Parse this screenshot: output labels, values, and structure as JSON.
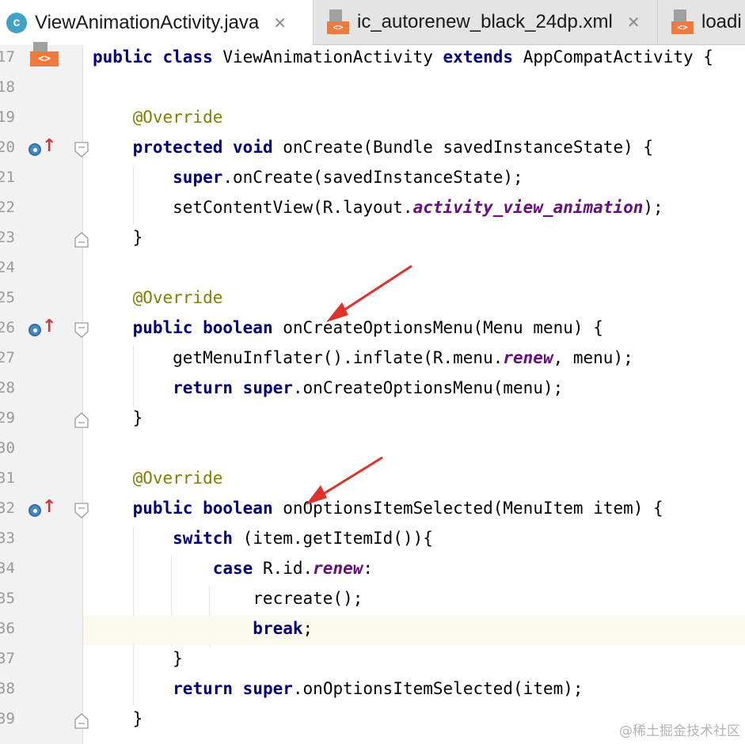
{
  "tabs": [
    {
      "label": "ViewAnimationActivity.java",
      "icon": "java-class-icon",
      "icon_text": "c",
      "active": true,
      "close": "✕"
    },
    {
      "label": "ic_autorenew_black_24dp.xml",
      "icon": "xml-file-icon",
      "icon_text": "<>",
      "active": false,
      "close": "✕"
    },
    {
      "label": "loadi",
      "icon": "xml-file-icon",
      "icon_text": "<>",
      "active": false
    }
  ],
  "editor": {
    "current_line": 36,
    "lines": [
      {
        "n": "17",
        "code": "public class ViewAnimationActivity extends AppCompatActivity {"
      },
      {
        "n": "18",
        "code": ""
      },
      {
        "n": "19",
        "code": "    @Override"
      },
      {
        "n": "20",
        "code": "    protected void onCreate(Bundle savedInstanceState) {"
      },
      {
        "n": "21",
        "code": "        super.onCreate(savedInstanceState);"
      },
      {
        "n": "22",
        "code": "        setContentView(R.layout.activity_view_animation);"
      },
      {
        "n": "23",
        "code": "    }"
      },
      {
        "n": "24",
        "code": ""
      },
      {
        "n": "25",
        "code": "    @Override"
      },
      {
        "n": "26",
        "code": "    public boolean onCreateOptionsMenu(Menu menu) {"
      },
      {
        "n": "27",
        "code": "        getMenuInflater().inflate(R.menu.renew, menu);"
      },
      {
        "n": "28",
        "code": "        return super.onCreateOptionsMenu(menu);"
      },
      {
        "n": "29",
        "code": "    }"
      },
      {
        "n": "30",
        "code": ""
      },
      {
        "n": "31",
        "code": "    @Override"
      },
      {
        "n": "32",
        "code": "    public boolean onOptionsItemSelected(MenuItem item) {"
      },
      {
        "n": "33",
        "code": "        switch (item.getItemId()){"
      },
      {
        "n": "34",
        "code": "            case R.id.renew:"
      },
      {
        "n": "35",
        "code": "                recreate();"
      },
      {
        "n": "36",
        "code": "                break;"
      },
      {
        "n": "37",
        "code": "        }"
      },
      {
        "n": "38",
        "code": "        return super.onOptionsItemSelected(item);"
      },
      {
        "n": "39",
        "code": "    }"
      }
    ]
  },
  "colors": {
    "keyword": "#000080",
    "annotation": "#808000",
    "static_field": "#660e7a",
    "current_line_bg": "#fcfaed",
    "annotation_arrow": "#e0312b",
    "override_marker": "#d2363b"
  },
  "watermark": "@稀土掘金技术社区"
}
